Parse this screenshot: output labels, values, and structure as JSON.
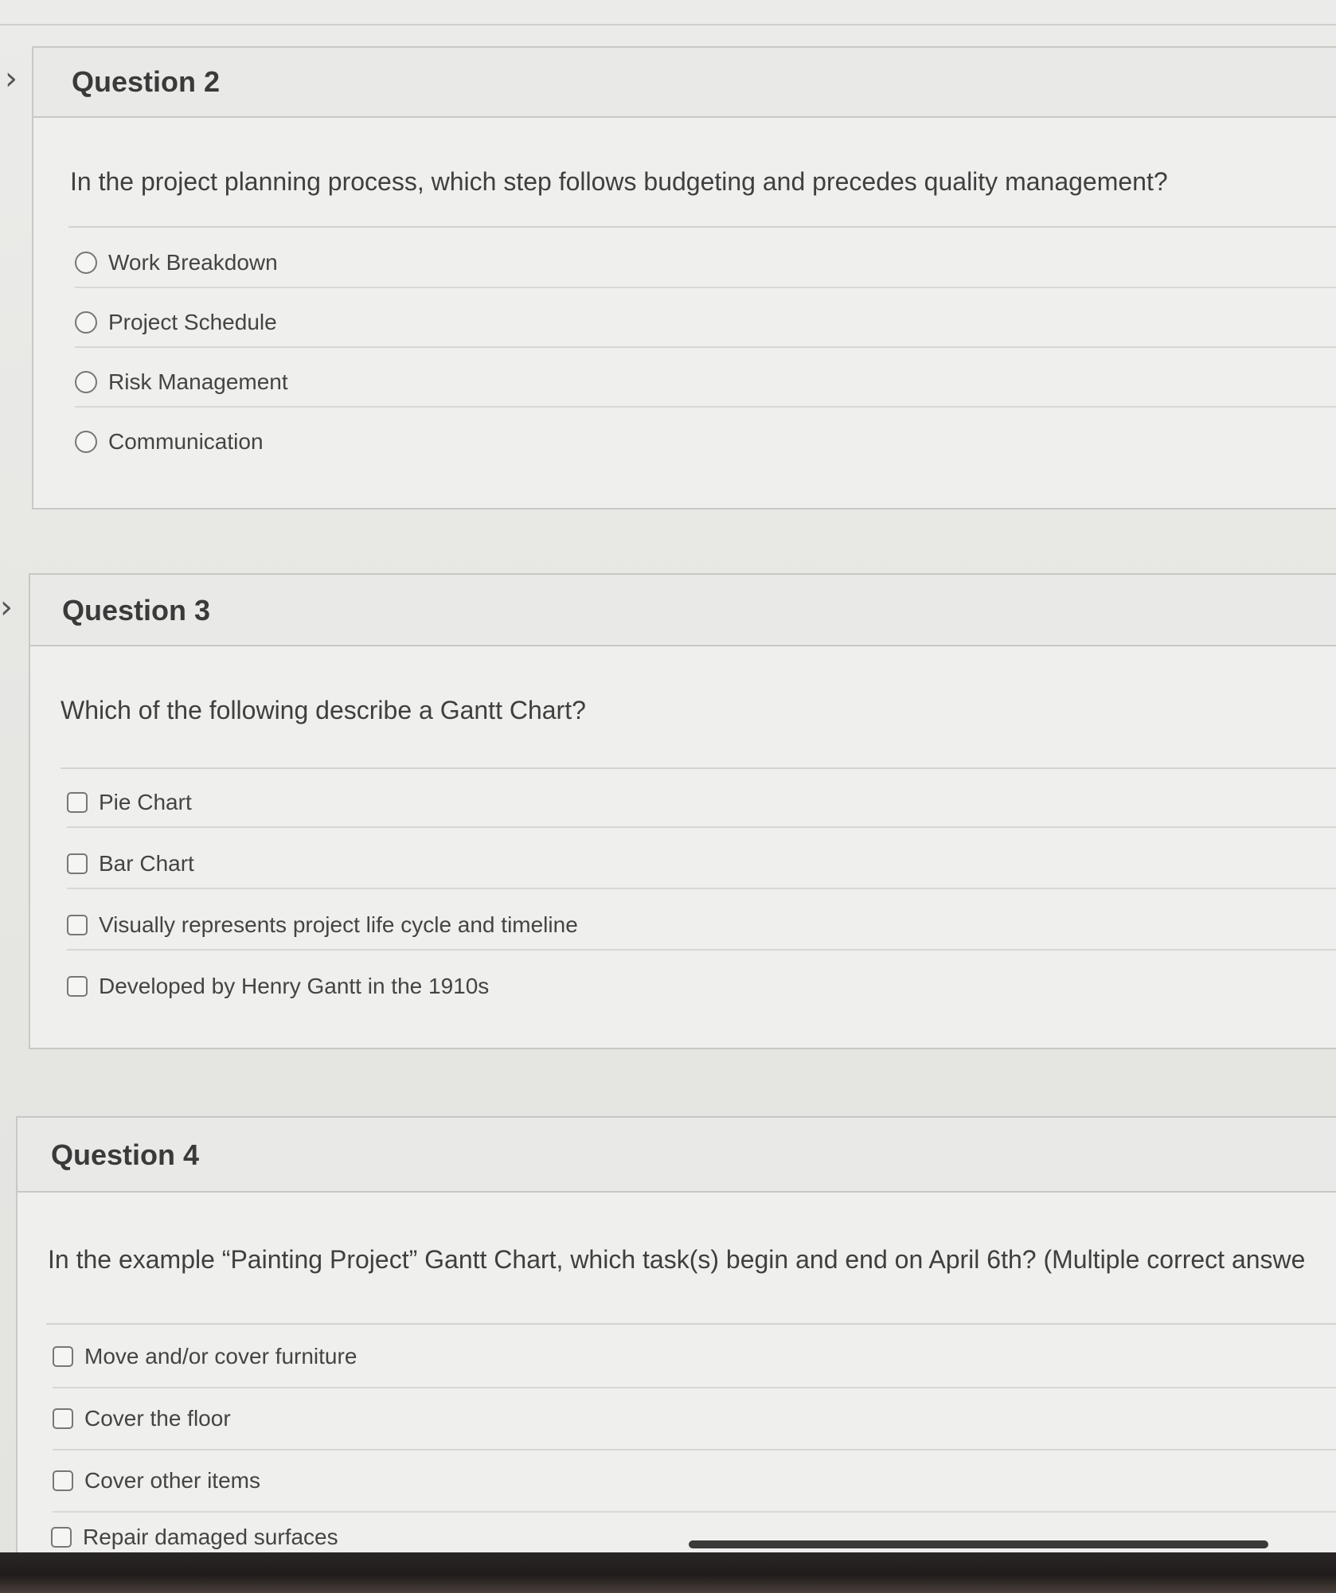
{
  "questions": [
    {
      "title": "Question 2",
      "prompt": "In the project planning process, which step follows budgeting and precedes quality management?",
      "input_type": "radio",
      "options": [
        "Work Breakdown",
        "Project Schedule",
        "Risk Management",
        "Communication"
      ]
    },
    {
      "title": "Question 3",
      "prompt": "Which of the following describe a Gantt Chart?",
      "input_type": "checkbox",
      "options": [
        "Pie Chart",
        "Bar Chart",
        "Visually represents project life cycle and timeline",
        "Developed by Henry Gantt in the 1910s"
      ]
    },
    {
      "title": "Question 4",
      "prompt": "In the example “Painting Project” Gantt Chart, which task(s) begin and end on April 6th? (Multiple correct answe",
      "input_type": "checkbox",
      "options": [
        "Move and/or cover furniture",
        "Cover the floor",
        "Cover other items",
        "Repair damaged surfaces"
      ]
    }
  ],
  "nav_icon": "chevron-right-icon",
  "colors": {
    "background": "#e8e8e6",
    "card": "#efefed",
    "border": "#c8c8c5",
    "text": "#3d3d3d"
  }
}
